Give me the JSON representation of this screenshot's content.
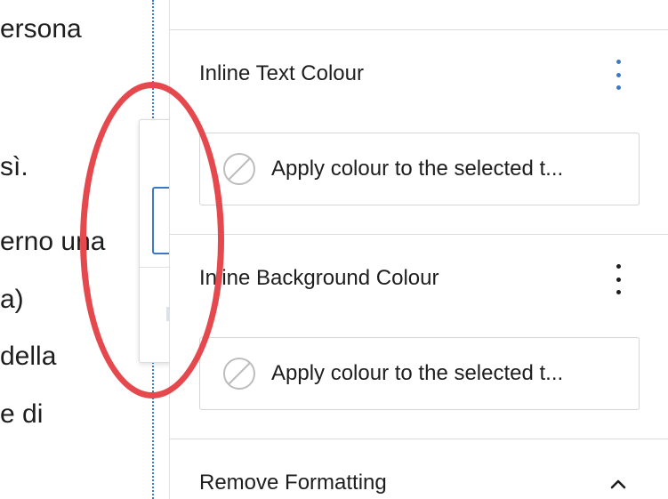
{
  "editor": {
    "lines": [
      "ersona",
      "sì.",
      "erno una",
      "a)",
      "della",
      "e di"
    ]
  },
  "sidebar": {
    "panels": [
      {
        "title": "Inline Text Colour",
        "apply_label": "Apply colour to the selected t..."
      },
      {
        "title": "Inline Background Colour",
        "apply_label": "Apply colour to the selected t..."
      },
      {
        "title": "Remove Formatting"
      }
    ]
  },
  "colors": {
    "annotation": "#e5484d",
    "accent": "#3a7cc4",
    "active_menu_dots": "#3a7cc4",
    "menu_dots": "#1e1e1e"
  },
  "icons": {
    "options": "vertical-ellipsis",
    "no_colour": "circle-slash",
    "collapse": "chevron-up"
  }
}
